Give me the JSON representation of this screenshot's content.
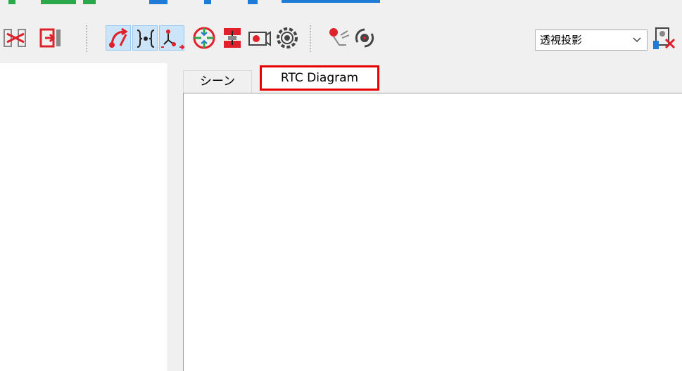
{
  "toolbar": {
    "projection_dropdown": {
      "selected": "透視投影",
      "icon": "chevron-down-icon"
    },
    "icons": [
      "disconnect-icon",
      "exit-icon",
      "rtc-link-icon",
      "braces-icon",
      "component-tree-icon",
      "target-crosshair-icon",
      "compress-icon",
      "camera-icon",
      "gear-icon",
      "view-camera-icon",
      "rotate-icon",
      "settings-icon"
    ],
    "colors": {
      "active_bg": "#cce4f7",
      "icon_red": "#e0202a",
      "icon_blue": "#1e7bd6",
      "icon_green": "#2aa84a"
    }
  },
  "tabs": [
    {
      "label": "シーン",
      "active": false
    },
    {
      "label": "RTC Diagram",
      "active": true
    }
  ],
  "highlight": {
    "color": "#e60000"
  }
}
